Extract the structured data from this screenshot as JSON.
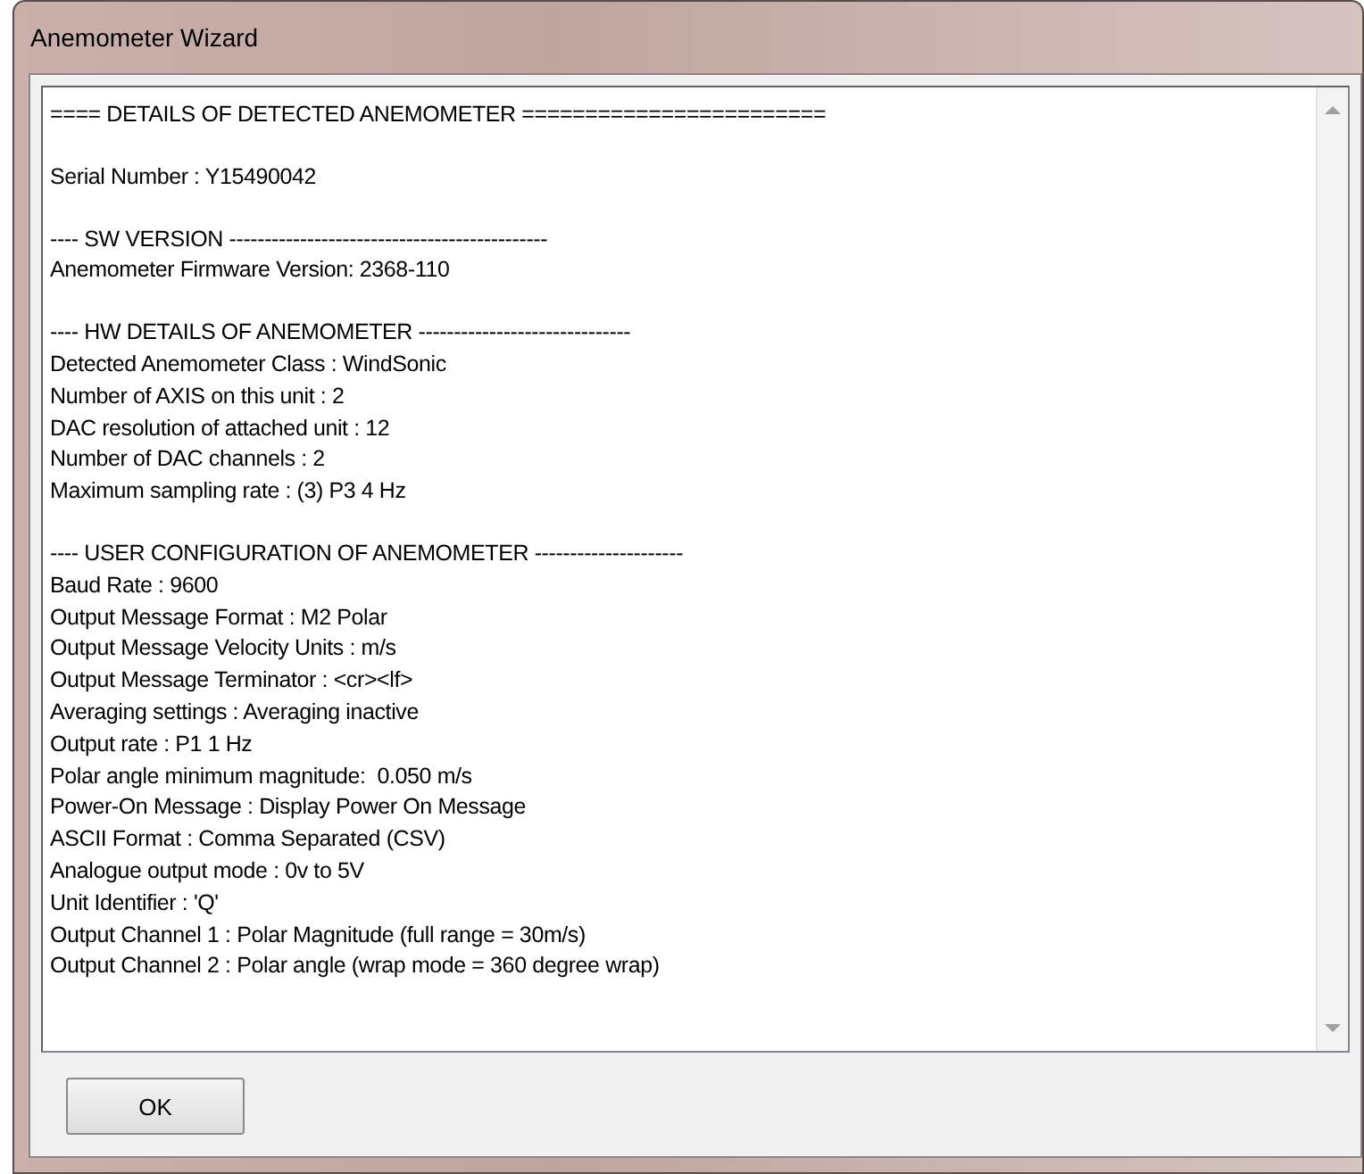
{
  "window": {
    "title": "Anemometer Wizard"
  },
  "sections": [
    {
      "lines": [
        "==== DETAILS OF DETECTED ANEMOMETER ========================"
      ]
    },
    {
      "lines": [
        "Serial Number : Y15490042"
      ]
    },
    {
      "lines": [
        "---- SW VERSION ---------------------------------------------",
        "Anemometer Firmware Version: 2368-110"
      ]
    },
    {
      "lines": [
        "---- HW DETAILS OF ANEMOMETER ------------------------------",
        "Detected Anemometer Class : WindSonic",
        "Number of AXIS on this unit : 2",
        "DAC resolution of attached unit : 12",
        "Number of DAC channels : 2",
        "Maximum sampling rate : (3) P3 4 Hz"
      ]
    },
    {
      "lines": [
        "---- USER CONFIGURATION OF ANEMOMETER ---------------------",
        "Baud Rate : 9600",
        "Output Message Format : M2 Polar",
        "Output Message Velocity Units : m/s",
        "Output Message Terminator : <cr><lf>",
        "Averaging settings : Averaging inactive",
        "Output rate : P1 1 Hz",
        "Polar angle minimum magnitude:  0.050 m/s",
        "Power-On Message : Display Power On Message",
        "ASCII Format : Comma Separated (CSV)",
        "Analogue output mode : 0v to 5V",
        "Unit Identifier : 'Q'",
        "Output Channel 1 : Polar Magnitude (full range = 30m/s)",
        "Output Channel 2 : Polar angle (wrap mode = 360 degree wrap)"
      ]
    }
  ],
  "buttons": [
    "OK"
  ]
}
